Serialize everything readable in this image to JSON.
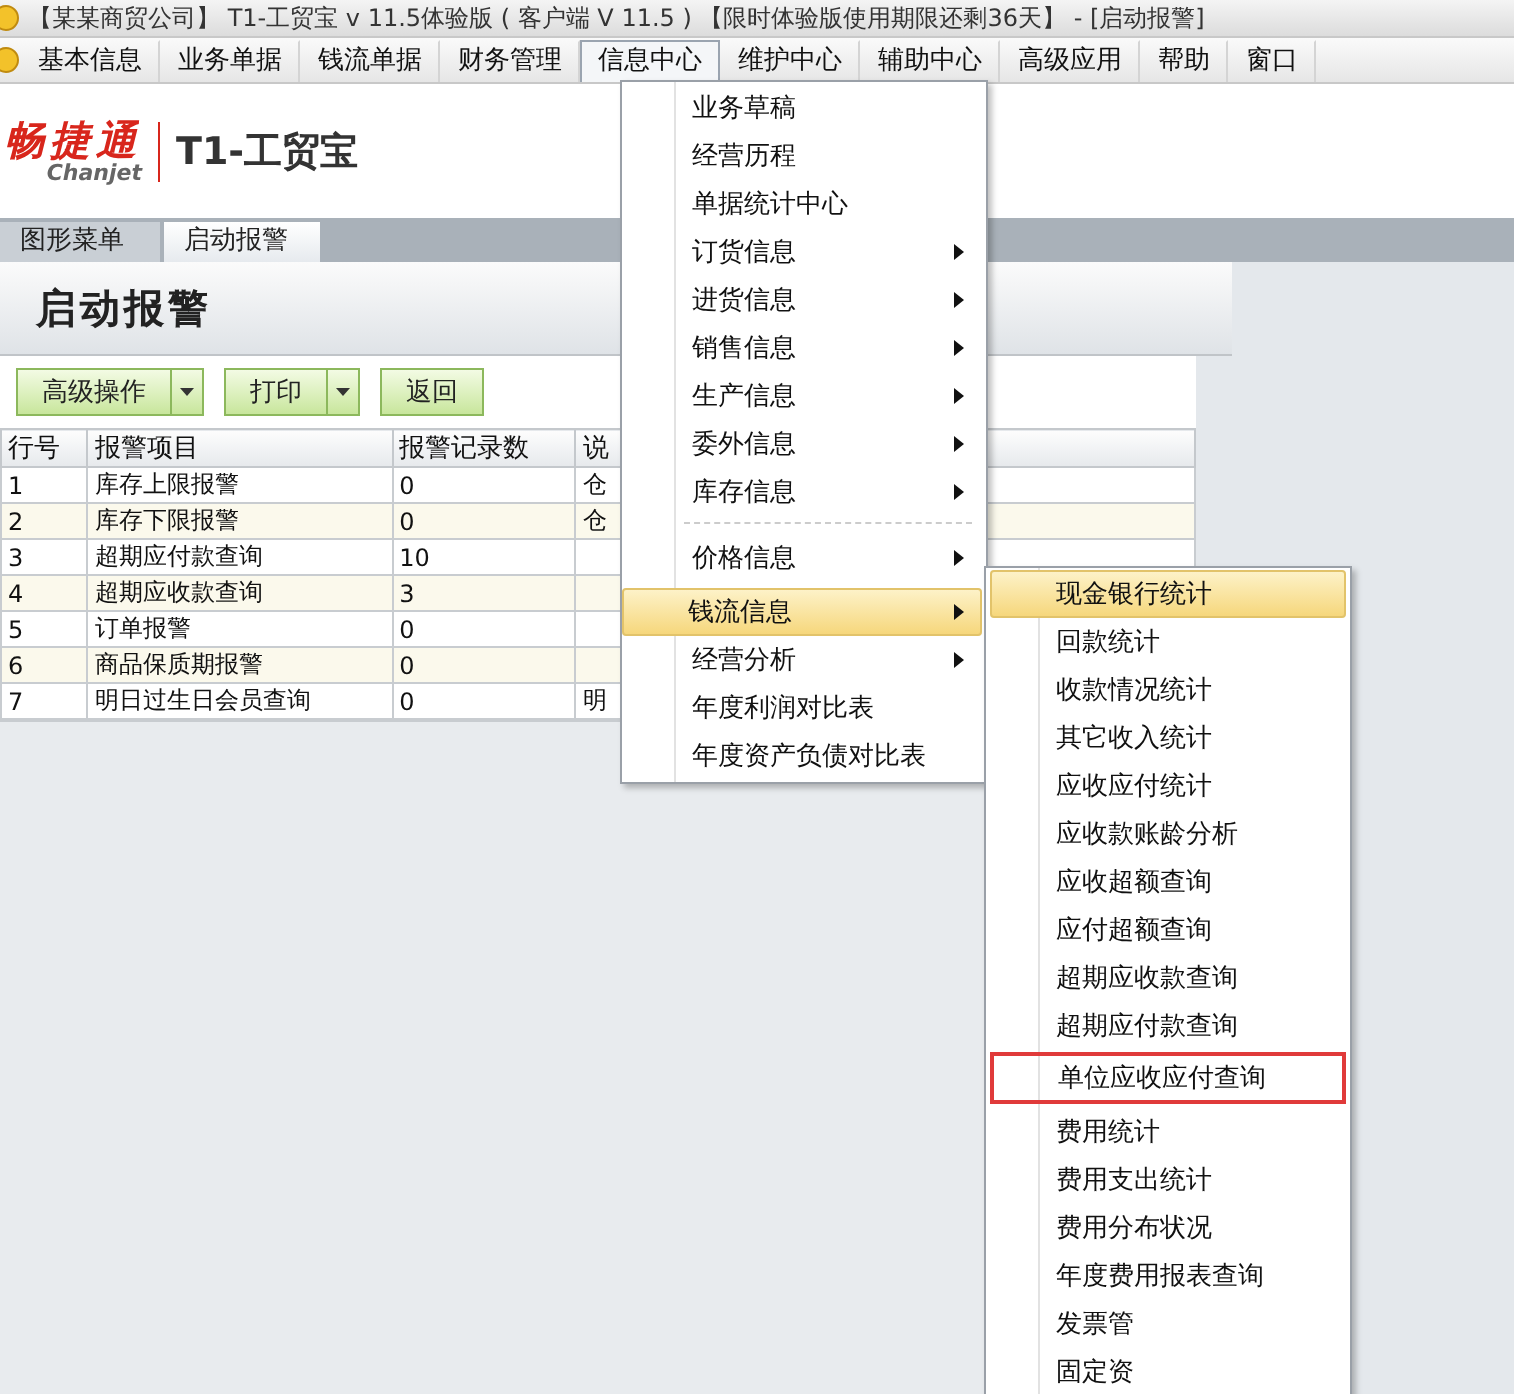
{
  "window": {
    "title": "【某某商贸公司】 T1-工贸宝 v 11.5体验版 ( 客户端 V 11.5 ) 【限时体验版使用期限还剩36天】 - [启动报警]"
  },
  "menu_bar": [
    {
      "label": "基本信息",
      "selected": false
    },
    {
      "label": "业务单据",
      "selected": false
    },
    {
      "label": "钱流单据",
      "selected": false
    },
    {
      "label": "财务管理",
      "selected": false
    },
    {
      "label": "信息中心",
      "selected": true
    },
    {
      "label": "维护中心",
      "selected": false
    },
    {
      "label": "辅助中心",
      "selected": false
    },
    {
      "label": "高级应用",
      "selected": false
    },
    {
      "label": "帮助",
      "selected": false
    },
    {
      "label": "窗口",
      "selected": false
    }
  ],
  "logo": {
    "brand": "畅捷通",
    "brand_sub": "Chanjet",
    "product": "T1-工贸宝"
  },
  "tabs": [
    {
      "label": "图形菜单",
      "selected": false
    },
    {
      "label": "启动报警",
      "selected": true
    }
  ],
  "page_title": "启动报警",
  "toolbar": [
    {
      "label": "高级操作",
      "dropdown": true
    },
    {
      "label": "打印",
      "dropdown": true
    },
    {
      "label": "返回",
      "dropdown": false
    }
  ],
  "table": {
    "columns": [
      "行号",
      "报警项目",
      "报警记录数",
      "说"
    ],
    "rows": [
      [
        "1",
        "库存上限报警",
        "0",
        "仓"
      ],
      [
        "2",
        "库存下限报警",
        "0",
        "仓"
      ],
      [
        "3",
        "超期应付款查询",
        "10",
        ""
      ],
      [
        "4",
        "超期应收款查询",
        "3",
        ""
      ],
      [
        "5",
        "订单报警",
        "0",
        ""
      ],
      [
        "6",
        "商品保质期报警",
        "0",
        ""
      ],
      [
        "7",
        "明日过生日会员查询",
        "0",
        "明"
      ]
    ]
  },
  "dropdown_menu": [
    {
      "label": "业务草稿",
      "submenu": false,
      "selected": false,
      "separator_before": false
    },
    {
      "label": "经营历程",
      "submenu": false,
      "selected": false,
      "separator_before": false
    },
    {
      "label": "单据统计中心",
      "submenu": false,
      "selected": false,
      "separator_before": false
    },
    {
      "label": "订货信息",
      "submenu": true,
      "selected": false,
      "separator_before": false
    },
    {
      "label": "进货信息",
      "submenu": true,
      "selected": false,
      "separator_before": false
    },
    {
      "label": "销售信息",
      "submenu": true,
      "selected": false,
      "separator_before": false
    },
    {
      "label": "生产信息",
      "submenu": true,
      "selected": false,
      "separator_before": false
    },
    {
      "label": "委外信息",
      "submenu": true,
      "selected": false,
      "separator_before": false
    },
    {
      "label": "库存信息",
      "submenu": true,
      "selected": false,
      "separator_before": false
    },
    {
      "label": "价格信息",
      "submenu": true,
      "selected": false,
      "separator_before": true
    },
    {
      "label": "钱流信息",
      "submenu": true,
      "selected": true,
      "separator_before": false
    },
    {
      "label": "经营分析",
      "submenu": true,
      "selected": false,
      "separator_before": false
    },
    {
      "label": "年度利润对比表",
      "submenu": false,
      "selected": false,
      "separator_before": false
    },
    {
      "label": "年度资产负债对比表",
      "submenu": false,
      "selected": false,
      "separator_before": false
    }
  ],
  "submenu": [
    {
      "label": "现金银行统计",
      "selected": true,
      "outlined": false
    },
    {
      "label": "回款统计",
      "selected": false,
      "outlined": false
    },
    {
      "label": "收款情况统计",
      "selected": false,
      "outlined": false
    },
    {
      "label": "其它收入统计",
      "selected": false,
      "outlined": false
    },
    {
      "label": "应收应付统计",
      "selected": false,
      "outlined": false
    },
    {
      "label": "应收款账龄分析",
      "selected": false,
      "outlined": false
    },
    {
      "label": "应收超额查询",
      "selected": false,
      "outlined": false
    },
    {
      "label": "应付超额查询",
      "selected": false,
      "outlined": false
    },
    {
      "label": "超期应收款查询",
      "selected": false,
      "outlined": false
    },
    {
      "label": "超期应付款查询",
      "selected": false,
      "outlined": false
    },
    {
      "label": "单位应收应付查询",
      "selected": false,
      "outlined": true
    },
    {
      "label": "费用统计",
      "selected": false,
      "outlined": false
    },
    {
      "label": "费用支出统计",
      "selected": false,
      "outlined": false
    },
    {
      "label": "费用分布状况",
      "selected": false,
      "outlined": false
    },
    {
      "label": "年度费用报表查询",
      "selected": false,
      "outlined": false
    },
    {
      "label": "发票管",
      "selected": false,
      "outlined": false
    },
    {
      "label": "固定资",
      "selected": false,
      "outlined": false
    }
  ]
}
